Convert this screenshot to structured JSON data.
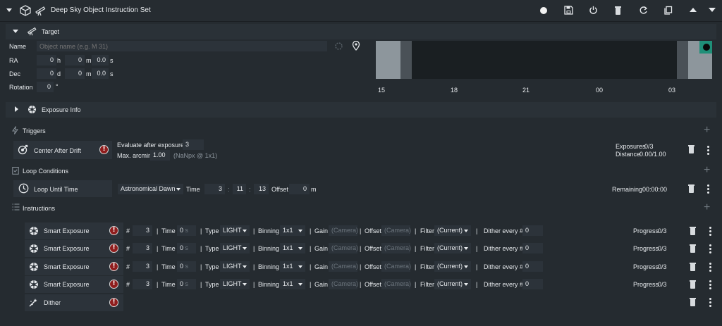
{
  "header": {
    "title": "Deep Sky Object Instruction Set"
  },
  "target": {
    "section_label": "Target",
    "name_label": "Name",
    "name_placeholder": "Object name (e.g. M 31)",
    "ra_label": "RA",
    "ra_h": "0",
    "ra_h_unit": "h",
    "ra_m": "0",
    "ra_m_unit": "m",
    "ra_s": "0.0",
    "ra_s_unit": "s",
    "dec_label": "Dec",
    "dec_d": "0",
    "dec_d_unit": "d",
    "dec_m": "0",
    "dec_m_unit": "m",
    "dec_s": "0.0",
    "dec_s_unit": "s",
    "rotation_label": "Rotation",
    "rotation_value": "0",
    "rotation_unit": "°"
  },
  "altitude_chart": {
    "ticks": [
      "15",
      "18",
      "21",
      "00",
      "03"
    ]
  },
  "exposure_info": {
    "label": "Exposure Info"
  },
  "triggers": {
    "section_label": "Triggers",
    "center_after_drift": {
      "name": "Center After Drift",
      "evaluate_label": "Evaluate after exposures",
      "evaluate_value": "3",
      "max_arcmin_label": "Max. arcmin",
      "max_arcmin_value": "1.00",
      "npx_hint": "(NaNpx @ 1x1)",
      "exposures_label": "Exposures",
      "exposures_value": "0/3",
      "distance_label": "Distance",
      "distance_value": "0.00/1.00"
    }
  },
  "loop_conditions": {
    "section_label": "Loop Conditions",
    "loop_until_time": {
      "name": "Loop Until Time",
      "source": "Astronomical Dawn",
      "time_label": "Time",
      "hours": "3",
      "minutes": "11",
      "seconds": "13",
      "offset_label": "Offset",
      "offset_value": "0",
      "offset_unit": "m",
      "remaining_label": "Remaining",
      "remaining_value": "00:00:00"
    }
  },
  "instructions": {
    "section_label": "Instructions",
    "items": [
      {
        "name": "Smart Exposure",
        "count_label": "#",
        "count": "3",
        "time_label": "Time",
        "time": "0",
        "time_unit": "s",
        "type_label": "Type",
        "type": "LIGHT",
        "binning_label": "Binning",
        "binning": "1x1",
        "gain_label": "Gain",
        "gain": "(Camera)",
        "offset_label": "Offset",
        "offset": "(Camera)",
        "filter_label": "Filter",
        "filter": "(Current)",
        "dither_label": "Dither every #",
        "dither": "0",
        "progress_label": "Progress",
        "progress": "0/3"
      },
      {
        "name": "Smart Exposure",
        "count_label": "#",
        "count": "3",
        "time_label": "Time",
        "time": "0",
        "time_unit": "s",
        "type_label": "Type",
        "type": "LIGHT",
        "binning_label": "Binning",
        "binning": "1x1",
        "gain_label": "Gain",
        "gain": "(Camera)",
        "offset_label": "Offset",
        "offset": "(Camera)",
        "filter_label": "Filter",
        "filter": "(Current)",
        "dither_label": "Dither every #",
        "dither": "0",
        "progress_label": "Progress",
        "progress": "0/3"
      },
      {
        "name": "Smart Exposure",
        "count_label": "#",
        "count": "3",
        "time_label": "Time",
        "time": "0",
        "time_unit": "s",
        "type_label": "Type",
        "type": "LIGHT",
        "binning_label": "Binning",
        "binning": "1x1",
        "gain_label": "Gain",
        "gain": "(Camera)",
        "offset_label": "Offset",
        "offset": "(Camera)",
        "filter_label": "Filter",
        "filter": "(Current)",
        "dither_label": "Dither every #",
        "dither": "0",
        "progress_label": "Progress",
        "progress": "0/3"
      },
      {
        "name": "Smart Exposure",
        "count_label": "#",
        "count": "3",
        "time_label": "Time",
        "time": "0",
        "time_unit": "s",
        "type_label": "Type",
        "type": "LIGHT",
        "binning_label": "Binning",
        "binning": "1x1",
        "gain_label": "Gain",
        "gain": "(Camera)",
        "offset_label": "Offset",
        "offset": "(Camera)",
        "filter_label": "Filter",
        "filter": "(Current)",
        "dither_label": "Dither every #",
        "dither": "0",
        "progress_label": "Progress",
        "progress": "0/3"
      }
    ],
    "dither": {
      "name": "Dither"
    }
  },
  "colors": {
    "background": "#252b30",
    "row": "#2c333a",
    "accent_teal": "#1f8f78",
    "warning_red": "#8f1d1d"
  }
}
